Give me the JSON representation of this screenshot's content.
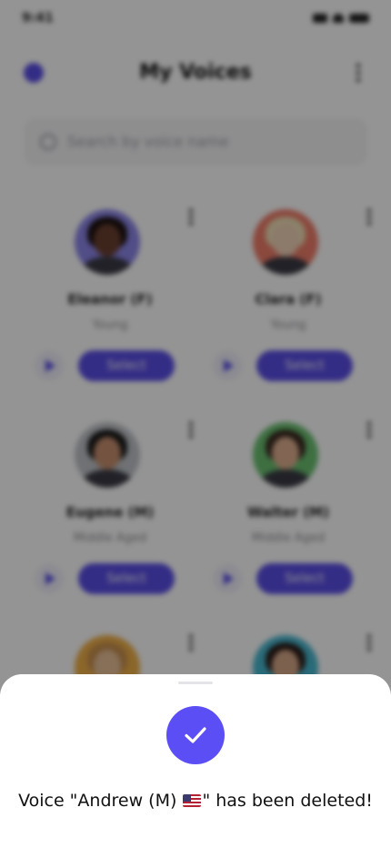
{
  "status_bar": {
    "time": "9:41"
  },
  "header": {
    "title": "My Voices"
  },
  "search": {
    "placeholder": "Search by voice name"
  },
  "voices": [
    {
      "name": "Eleanor (F)",
      "age": "Young",
      "select_label": "Select",
      "avatar_bg": "#8c85e8",
      "skin": "#6b4030",
      "hair": "#1c1210"
    },
    {
      "name": "Clara (F)",
      "age": "Young",
      "select_label": "Select",
      "avatar_bg": "#ef7d6a",
      "skin": "#f2d2b8",
      "hair": "#f0e0b8"
    },
    {
      "name": "Eugene (M)",
      "age": "Middle Aged",
      "select_label": "Select",
      "avatar_bg": "#bfc3c8",
      "skin": "#c89070",
      "hair": "#1a1a1a"
    },
    {
      "name": "Walter (M)",
      "age": "Middle Aged",
      "select_label": "Select",
      "avatar_bg": "#6ac070",
      "skin": "#e0b090",
      "hair": "#3a2a22"
    },
    {
      "name": "",
      "age": "",
      "select_label": "",
      "avatar_bg": "#f0b048",
      "skin": "#e8c098",
      "hair": "#c89050"
    },
    {
      "name": "",
      "age": "",
      "select_label": "",
      "avatar_bg": "#48b8d0",
      "skin": "#d8a888",
      "hair": "#2a1c18"
    }
  ],
  "toast": {
    "message_before": "Voice \"Andrew (M) ",
    "message_after": "\" has been deleted!",
    "flag": "us-flag-icon"
  },
  "colors": {
    "accent": "#5a4ee6",
    "badge": "#5b4ef5"
  }
}
